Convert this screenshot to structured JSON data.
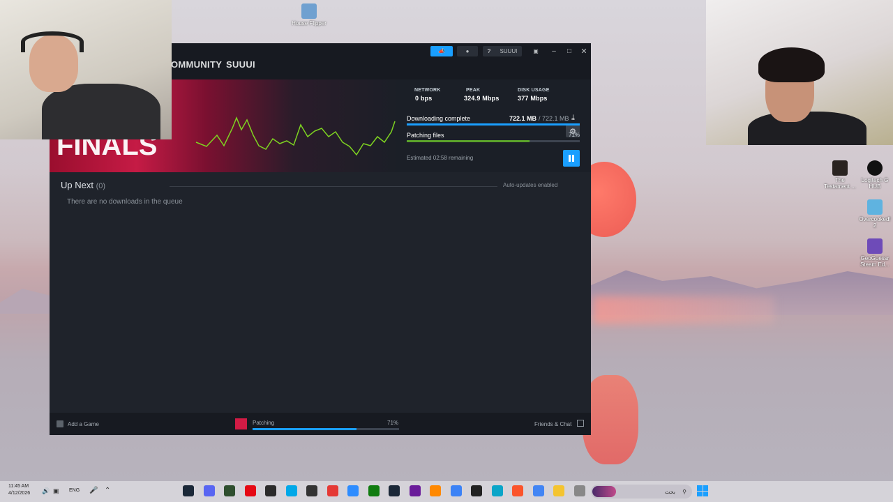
{
  "desktop_icons": [
    {
      "label": "House Flipper",
      "color": "#6fa0d0"
    },
    {
      "label": "The Testament ...",
      "color": "#2a2320"
    },
    {
      "label": "Logitech G HUB",
      "color": "#111111"
    },
    {
      "label": "Overcooked! 2",
      "color": "#5fb3e0"
    },
    {
      "label": "GeoGuessr Steam Ed...",
      "color": "#6e4bb8"
    }
  ],
  "steam": {
    "nav": {
      "community": "OMMUNITY",
      "user": "SUUUI"
    },
    "topbar": {
      "user_menu": "SUUUI",
      "help": "?"
    },
    "stats": {
      "network_label": "NETWORK",
      "network_value": "0 bps",
      "peak_label": "PEAK",
      "peak_value": "324.9 Mbps",
      "disk_label": "DISK USAGE",
      "disk_value": "377 Mbps"
    },
    "download": {
      "status_label": "Downloading complete",
      "downloaded": "722.1 MB",
      "total": "/ 722.1 MB",
      "patch_label": "Patching files",
      "patch_percent": "71%",
      "patch_progress": 0.71,
      "estimate": "Estimated 02:58 remaining"
    },
    "queue": {
      "title": "Up Next",
      "count": "(0)",
      "auto_updates": "Auto-updates enabled",
      "empty_message": "There are no downloads in the queue"
    },
    "footer": {
      "add_game": "Add a Game",
      "patching": "Patching",
      "percent": "71%",
      "friends": "Friends & Chat"
    },
    "colors": {
      "accent": "#1a9fff",
      "graph": "#7ed321",
      "patch_bar": "#5ba32b"
    }
  },
  "taskbar": {
    "time": "11:45 AM",
    "date": "4/12/2026",
    "lang": "ENG",
    "search_placeholder": "بحث",
    "icons": [
      "steam-icon",
      "discord-icon",
      "app-icon",
      "netflix-icon",
      "davinci-icon",
      "capcut-icon",
      "obs-icon",
      "youtube-music-icon",
      "zoom-icon",
      "xbox-icon",
      "steam-icon-2",
      "headphones-icon",
      "vlc-icon",
      "store-icon",
      "davinci-2-icon",
      "edge-icon",
      "brave-icon",
      "chrome-icon",
      "explorer-icon",
      "notepad-icon"
    ]
  }
}
